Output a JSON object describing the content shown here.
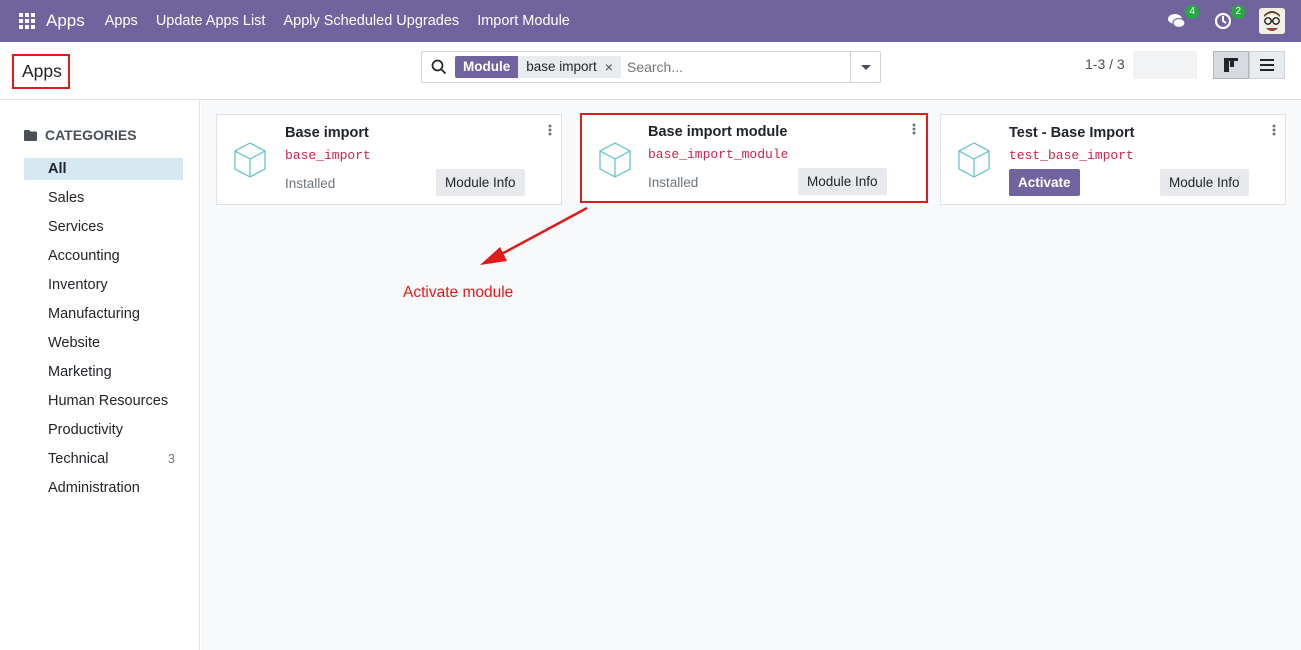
{
  "navbar": {
    "brand": "Apps",
    "menu": [
      "Apps",
      "Update Apps List",
      "Apply Scheduled Upgrades",
      "Import Module"
    ],
    "chat_badge": "4",
    "activity_badge": "2"
  },
  "control": {
    "breadcrumb": "Apps",
    "search": {
      "facet_label": "Module",
      "facet_value": "base import",
      "placeholder": "Search..."
    },
    "pager": "1-3 / 3"
  },
  "sidebar": {
    "heading": "CATEGORIES",
    "items": [
      {
        "label": "All",
        "count": ""
      },
      {
        "label": "Sales",
        "count": ""
      },
      {
        "label": "Services",
        "count": ""
      },
      {
        "label": "Accounting",
        "count": ""
      },
      {
        "label": "Inventory",
        "count": ""
      },
      {
        "label": "Manufacturing",
        "count": ""
      },
      {
        "label": "Website",
        "count": ""
      },
      {
        "label": "Marketing",
        "count": ""
      },
      {
        "label": "Human Resources",
        "count": ""
      },
      {
        "label": "Productivity",
        "count": ""
      },
      {
        "label": "Technical",
        "count": "3"
      },
      {
        "label": "Administration",
        "count": ""
      }
    ]
  },
  "cards": [
    {
      "title": "Base import",
      "tech_name": "base_import",
      "status": "Installed",
      "info_label": "Module Info"
    },
    {
      "title": "Base import module",
      "tech_name": "base_import_module",
      "status": "Installed",
      "info_label": "Module Info"
    },
    {
      "title": "Test - Base Import",
      "tech_name": "test_base_import",
      "activate_label": "Activate",
      "info_label": "Module Info"
    }
  ],
  "annotation": "Activate module",
  "colors": {
    "brand": "#71639e",
    "annotation": "#e01b1b",
    "tech_name": "#c7254e"
  }
}
